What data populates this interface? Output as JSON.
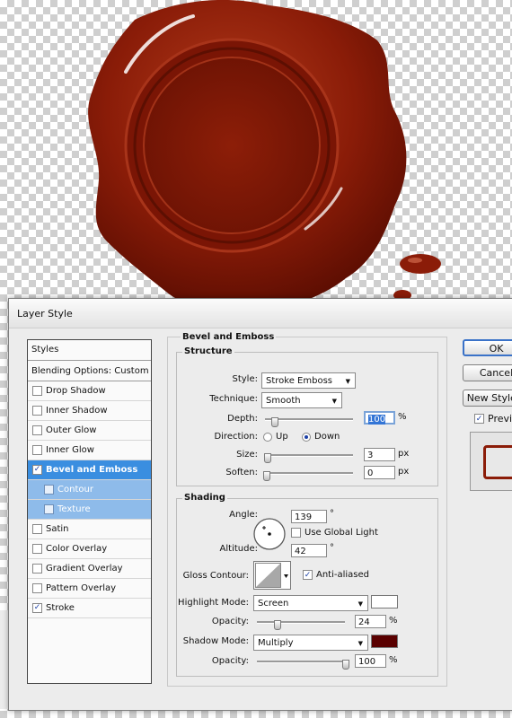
{
  "dialog": {
    "title": "Layer Style"
  },
  "styles_list": {
    "header": "Styles",
    "blending_options": "Blending Options: Custom",
    "items": [
      {
        "label": "Drop Shadow",
        "checked": false
      },
      {
        "label": "Inner Shadow",
        "checked": false
      },
      {
        "label": "Outer Glow",
        "checked": false
      },
      {
        "label": "Inner Glow",
        "checked": false
      },
      {
        "label": "Bevel and Emboss",
        "checked": true
      },
      {
        "label": "Contour",
        "checked": false
      },
      {
        "label": "Texture",
        "checked": false
      },
      {
        "label": "Satin",
        "checked": false
      },
      {
        "label": "Color Overlay",
        "checked": false
      },
      {
        "label": "Gradient Overlay",
        "checked": false
      },
      {
        "label": "Pattern Overlay",
        "checked": false
      },
      {
        "label": "Stroke",
        "checked": true
      }
    ]
  },
  "bevel": {
    "section_title": "Bevel and Emboss",
    "structure": {
      "title": "Structure",
      "style_label": "Style:",
      "style_value": "Stroke Emboss",
      "technique_label": "Technique:",
      "technique_value": "Smooth",
      "depth_label": "Depth:",
      "depth_value": "100",
      "depth_unit": "%",
      "direction_label": "Direction:",
      "direction_up": "Up",
      "direction_down": "Down",
      "size_label": "Size:",
      "size_value": "3",
      "size_unit": "px",
      "soften_label": "Soften:",
      "soften_value": "0",
      "soften_unit": "px"
    },
    "shading": {
      "title": "Shading",
      "angle_label": "Angle:",
      "angle_value": "139",
      "angle_unit": "°",
      "use_global_light": "Use Global Light",
      "altitude_label": "Altitude:",
      "altitude_value": "42",
      "altitude_unit": "°",
      "gloss_contour_label": "Gloss Contour:",
      "anti_aliased": "Anti-aliased",
      "highlight_mode_label": "Highlight Mode:",
      "highlight_mode_value": "Screen",
      "highlight_color": "#ffffff",
      "highlight_opacity_label": "Opacity:",
      "highlight_opacity_value": "24",
      "highlight_opacity_unit": "%",
      "shadow_mode_label": "Shadow Mode:",
      "shadow_mode_value": "Multiply",
      "shadow_color": "#5a0000",
      "shadow_opacity_label": "Opacity:",
      "shadow_opacity_value": "100",
      "shadow_opacity_unit": "%"
    }
  },
  "buttons": {
    "ok": "OK",
    "cancel": "Cancel",
    "new_style": "New Style...",
    "preview": "Preview"
  },
  "colors": {
    "wax": "#8b1c08",
    "selection": "#3a8ee0"
  }
}
